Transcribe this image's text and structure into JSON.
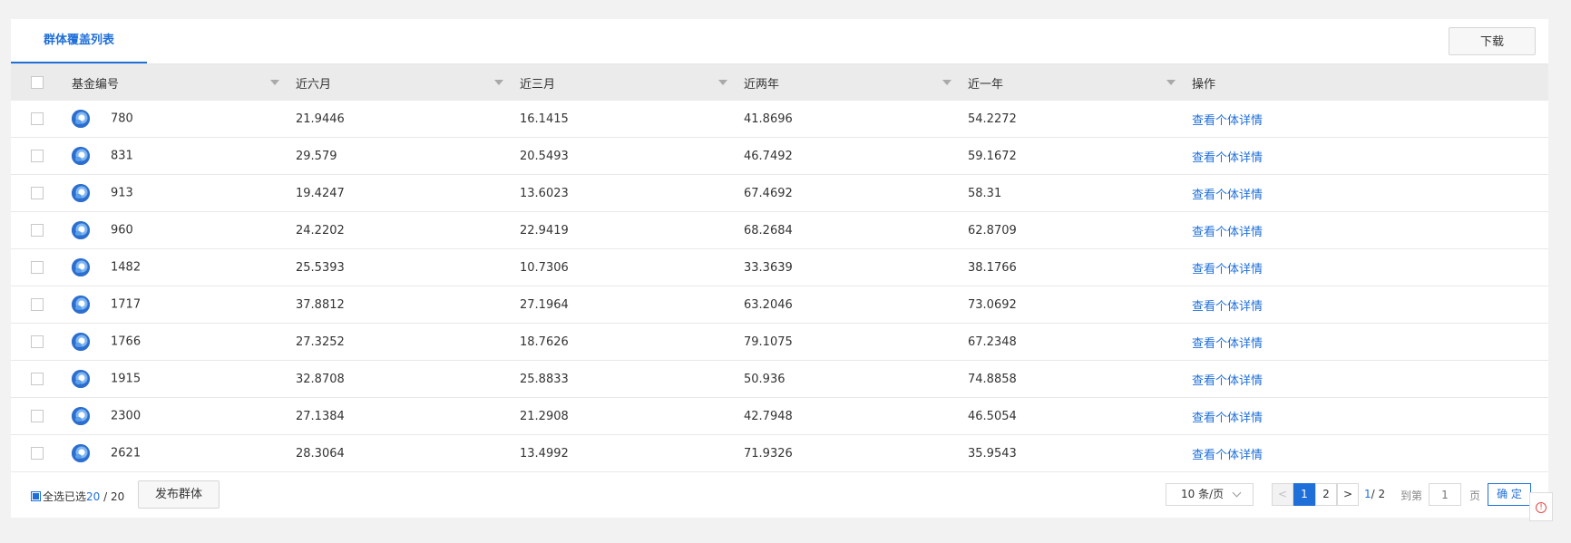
{
  "tabs": [
    {
      "label": "群体覆盖列表",
      "active": true
    }
  ],
  "toolbar": {
    "download_label": "下载"
  },
  "table": {
    "columns": [
      "基金编号",
      "近六月",
      "近三月",
      "近两年",
      "近一年",
      "操作"
    ],
    "rows": [
      {
        "id": "780",
        "m6": "21.9446",
        "m3": "16.1415",
        "y2": "41.8696",
        "y1": "54.2272",
        "action": "查看个体详情"
      },
      {
        "id": "831",
        "m6": "29.579",
        "m3": "20.5493",
        "y2": "46.7492",
        "y1": "59.1672",
        "action": "查看个体详情"
      },
      {
        "id": "913",
        "m6": "19.4247",
        "m3": "13.6023",
        "y2": "67.4692",
        "y1": "58.31",
        "action": "查看个体详情"
      },
      {
        "id": "960",
        "m6": "24.2202",
        "m3": "22.9419",
        "y2": "68.2684",
        "y1": "62.8709",
        "action": "查看个体详情"
      },
      {
        "id": "1482",
        "m6": "25.5393",
        "m3": "10.7306",
        "y2": "33.3639",
        "y1": "38.1766",
        "action": "查看个体详情"
      },
      {
        "id": "1717",
        "m6": "37.8812",
        "m3": "27.1964",
        "y2": "63.2046",
        "y1": "73.0692",
        "action": "查看个体详情"
      },
      {
        "id": "1766",
        "m6": "27.3252",
        "m3": "18.7626",
        "y2": "79.1075",
        "y1": "67.2348",
        "action": "查看个体详情"
      },
      {
        "id": "1915",
        "m6": "32.8708",
        "m3": "25.8833",
        "y2": "50.936",
        "y1": "74.8858",
        "action": "查看个体详情"
      },
      {
        "id": "2300",
        "m6": "27.1384",
        "m3": "21.2908",
        "y2": "42.7948",
        "y1": "46.5054",
        "action": "查看个体详情"
      },
      {
        "id": "2621",
        "m6": "28.3064",
        "m3": "13.4992",
        "y2": "71.9326",
        "y1": "35.9543",
        "action": "查看个体详情"
      }
    ]
  },
  "footer": {
    "select_all_label": "全选已选",
    "selected_count": "20",
    "total_sep": " / 20",
    "publish_label": "发布群体"
  },
  "pagination": {
    "page_size_label": "10 条/页",
    "prev_symbol": "<",
    "pages": [
      "1",
      "2"
    ],
    "next_symbol": ">",
    "current_page": "1",
    "total_pages": "/ 2",
    "goto_label": "到第",
    "goto_placeholder": "1",
    "page_unit": "页",
    "confirm_label": "确 定"
  },
  "help": {
    "symbol": "!"
  },
  "colors": {
    "accent": "#1f6fd8",
    "header_bg": "#ebebeb",
    "page_bg": "#f2f2f2"
  }
}
